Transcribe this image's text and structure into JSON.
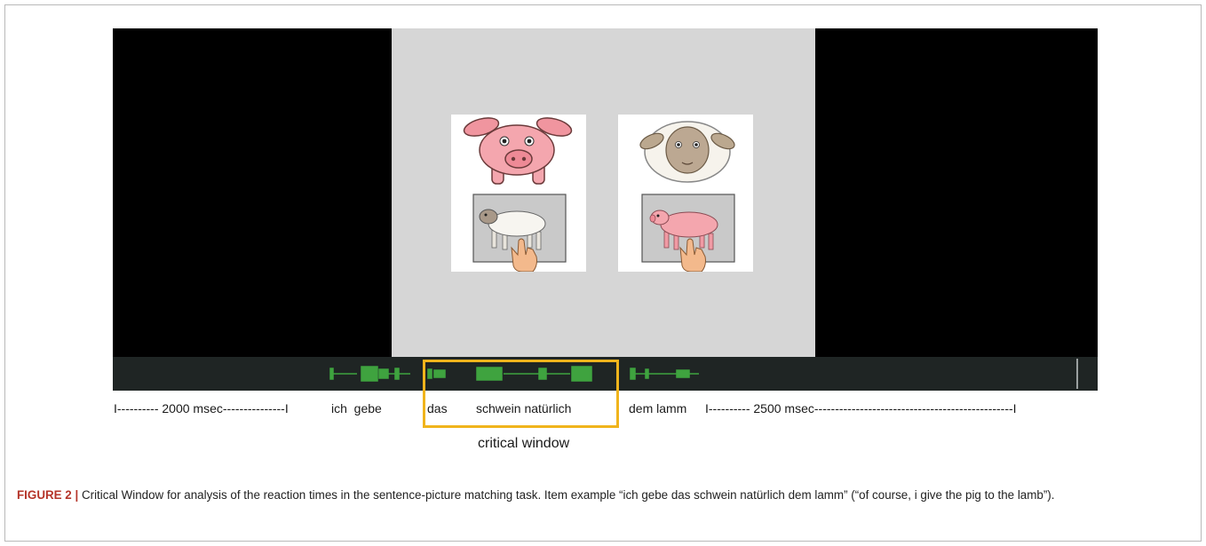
{
  "timeline": {
    "start_segment": "I---------- 2000 msec---------------I",
    "words_before": "ich  gebe",
    "word_das": "das",
    "words_critical": "schwein natürlich",
    "words_after": "dem lamm",
    "end_segment": "I---------- 2500 msec------------------------------------------------I"
  },
  "critical_label": "critical window",
  "caption": {
    "figure_label": "FIGURE 2 |",
    "text": " Critical Window for analysis of the reaction times in the sentence-picture matching task. Item example “ich gebe das schwein natürlich dem lamm” (“of course, i give the pig to the lamb”)."
  },
  "colors": {
    "highlight": "#f0b41c",
    "waveform": "#3fa33f",
    "pig": "#f4a6ae",
    "sheep": "#f3efe8"
  },
  "icons": [
    "pig-icon",
    "sheep-icon",
    "hand-icon"
  ]
}
